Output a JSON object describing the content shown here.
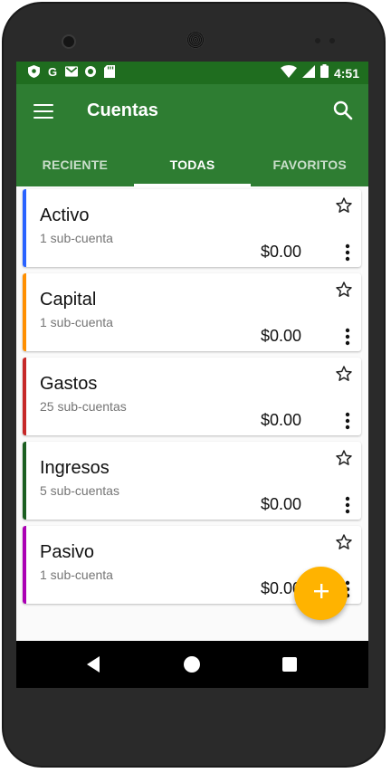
{
  "status_bar": {
    "time": "4:51",
    "left_icons": [
      "shield-icon",
      "google-icon",
      "gmail-icon",
      "circle-icon",
      "sd-card-icon"
    ],
    "right_icons": [
      "wifi-icon",
      "signal-icon",
      "battery-icon"
    ]
  },
  "app_bar": {
    "title": "Cuentas",
    "menu_icon": "menu-icon",
    "search_icon": "search-icon"
  },
  "tabs": [
    {
      "label": "RECIENTE",
      "active": false
    },
    {
      "label": "TODAS",
      "active": true
    },
    {
      "label": "FAVORITOS",
      "active": false
    }
  ],
  "accounts": [
    {
      "name": "Activo",
      "subaccounts": "1 sub-cuenta",
      "balance": "$0.00",
      "color": "#2962ff"
    },
    {
      "name": "Capital",
      "subaccounts": "1 sub-cuenta",
      "balance": "$0.00",
      "color": "#ff8f00"
    },
    {
      "name": "Gastos",
      "subaccounts": "25 sub-cuentas",
      "balance": "$0.00",
      "color": "#c62828"
    },
    {
      "name": "Ingresos",
      "subaccounts": "5 sub-cuentas",
      "balance": "$0.00",
      "color": "#1b5e20"
    },
    {
      "name": "Pasivo",
      "subaccounts": "1 sub-cuenta",
      "balance": "$0.00",
      "color": "#ab00b4"
    }
  ],
  "fab": {
    "icon": "plus-icon",
    "color": "#ffb300"
  },
  "colors": {
    "primary": "#2e7d32",
    "primary_dark": "#1f6d1f",
    "accent": "#ffb300"
  }
}
